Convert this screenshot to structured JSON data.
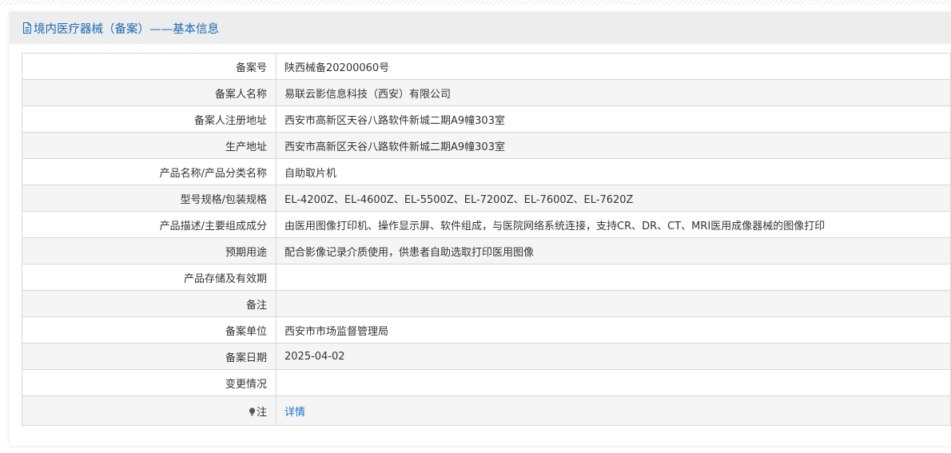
{
  "header": {
    "icon": "document-icon",
    "title": "境内医疗器械（备案）——基本信息"
  },
  "rows": [
    {
      "label": "备案号",
      "value": "陕西械备20200060号"
    },
    {
      "label": "备案人名称",
      "value": "易联云影信息科技（西安）有限公司"
    },
    {
      "label": "备案人注册地址",
      "value": "西安市高新区天谷八路软件新城二期A9幢303室"
    },
    {
      "label": "生产地址",
      "value": "西安市高新区天谷八路软件新城二期A9幢303室"
    },
    {
      "label": "产品名称/产品分类名称",
      "value": "自助取片机"
    },
    {
      "label": "型号规格/包装规格",
      "value": "EL-4200Z、EL-4600Z、EL-5500Z、EL-7200Z、EL-7600Z、EL-7620Z"
    },
    {
      "label": "产品描述/主要组成成分",
      "value": "由医用图像打印机、操作显示屏、软件组成，与医院网络系统连接，支持CR、DR、CT、MRI医用成像器械的图像打印"
    },
    {
      "label": "预期用途",
      "value": "配合影像记录介质使用，供患者自助选取打印医用图像"
    },
    {
      "label": "产品存储及有效期",
      "value": ""
    },
    {
      "label": "备注",
      "value": ""
    },
    {
      "label": "备案单位",
      "value": "西安市市场监督管理局"
    },
    {
      "label": "备案日期",
      "value": "2025-04-02"
    },
    {
      "label": "变更情况",
      "value": ""
    }
  ],
  "note_row": {
    "icon": "lightbulb-icon",
    "label": "注",
    "link_text": "详情"
  }
}
